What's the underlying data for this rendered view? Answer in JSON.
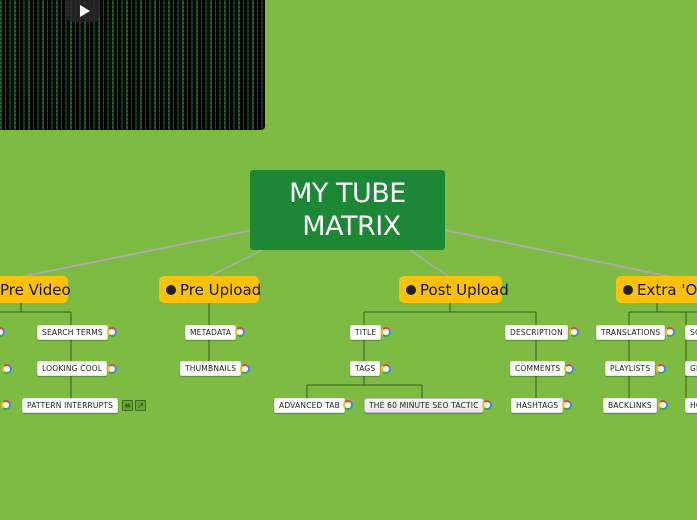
{
  "video": {
    "icon": "play-icon"
  },
  "root": {
    "line1": "MY TUBE",
    "line2": "MATRIX"
  },
  "branches": [
    {
      "label": "Pre Video",
      "has_dot": false,
      "children": [
        "SEARCH TERMS",
        "LOOKING COOL",
        "PATTERN INTERRUPTS"
      ]
    },
    {
      "label": "Pre Upload",
      "has_dot": true,
      "children": [
        "METADATA",
        "THUMBNAILS"
      ]
    },
    {
      "label": "Post Upload",
      "has_dot": true,
      "children": [
        "TITLE",
        "TAGS",
        "DESCRIPTION",
        "COMMENTS",
        "HASHTAGS"
      ],
      "tags_children": [
        "ADVANCED TAB",
        "THE 60 MINUTE SEO TACTIC"
      ]
    },
    {
      "label": "Extra 'Oo",
      "has_dot": true,
      "children": [
        "TRANSLATIONS",
        "PLAYLISTS",
        "BACKLINKS",
        "SC",
        "GE",
        "HC"
      ]
    }
  ],
  "icons": {
    "google": "google-icon",
    "notes": "notes-icon",
    "link": "external-link-icon"
  },
  "colors": {
    "background": "#7dbb42",
    "root": "#1c8734",
    "main_topic": "#fdc10a",
    "connector": "#aaaaaa",
    "branch_line": "#3c5a1c"
  }
}
